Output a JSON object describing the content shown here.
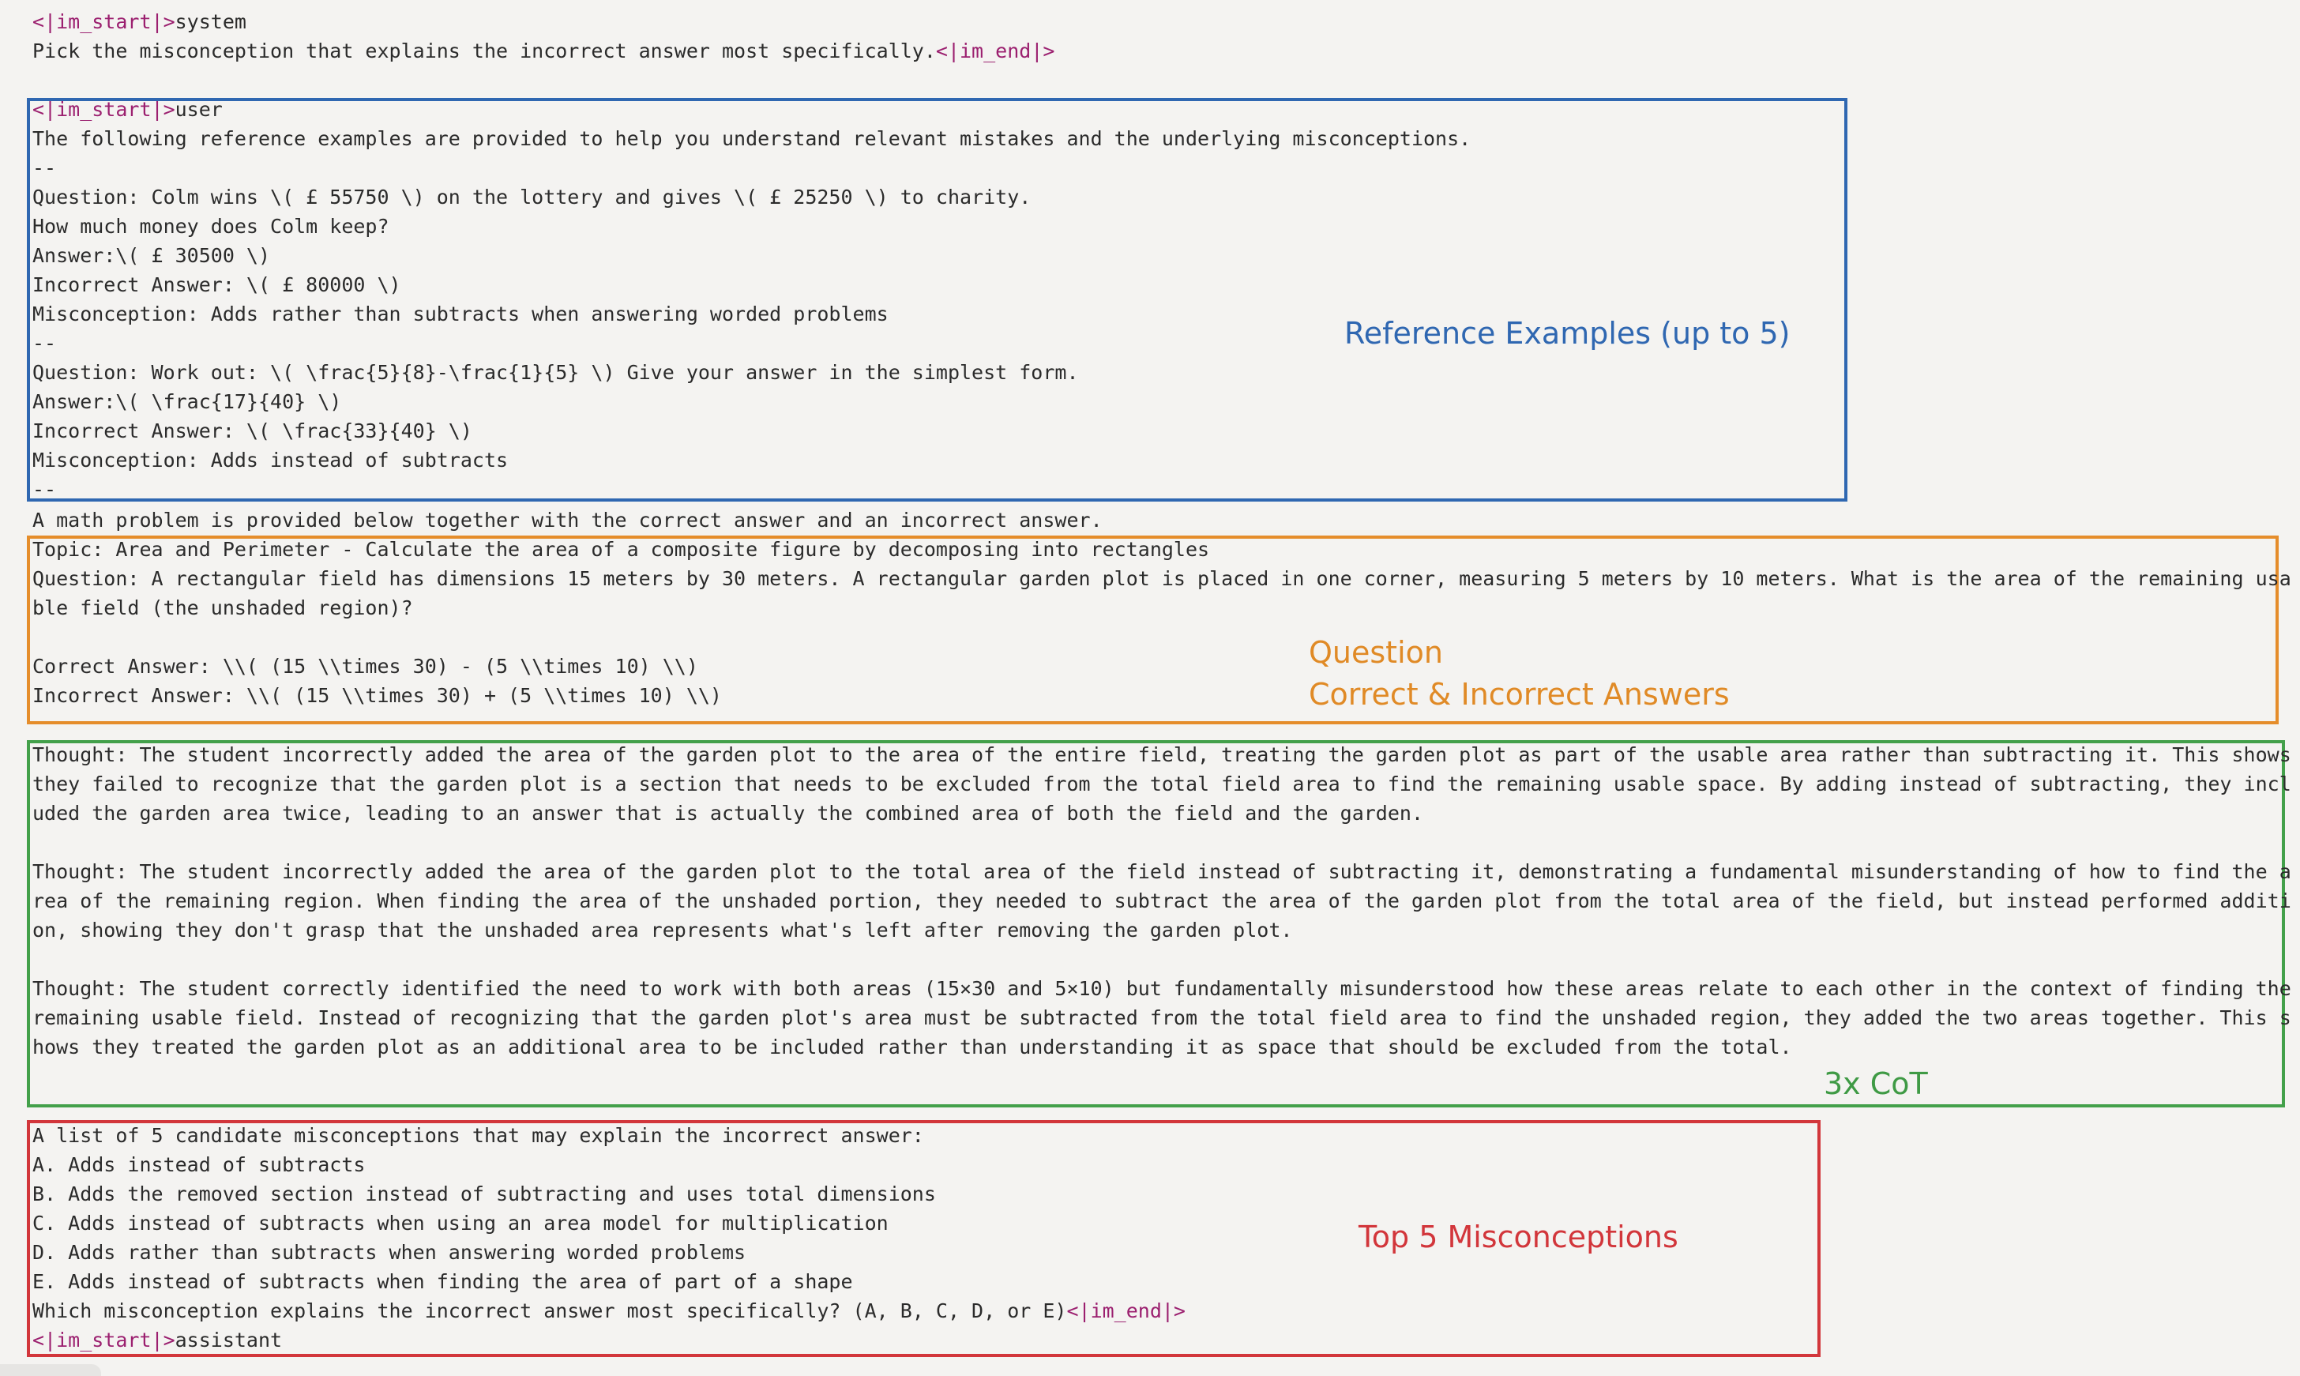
{
  "system_block": {
    "start_token": "<|im_start|>",
    "role": "system",
    "instruction": "Pick the misconception that explains the incorrect answer most specifically.",
    "end_token": "<|im_end|>"
  },
  "user_block": {
    "start_token": "<|im_start|>",
    "role": "user",
    "intro": "The following reference examples are provided to help you understand relevant mistakes and the underlying misconceptions.",
    "separator": "--",
    "examples": [
      {
        "question_line1": "Question: Colm wins \\( £ 55750 \\) on the lottery and gives \\( £ 25250 \\) to charity.",
        "question_line2": "How much money does Colm keep?",
        "answer": "Answer:\\( £ 30500 \\)",
        "incorrect": "Incorrect Answer: \\( £ 80000 \\)",
        "misconception": "Misconception: Adds rather than subtracts when answering worded problems"
      },
      {
        "question_line1": "Question: Work out: \\( \\frac{5}{8}-\\frac{1}{5} \\) Give your answer in the simplest form.",
        "answer": "Answer:\\( \\frac{17}{40} \\)",
        "incorrect": "Incorrect Answer: \\( \\frac{33}{40} \\)",
        "misconception": "Misconception: Adds instead of subtracts"
      }
    ]
  },
  "problem": {
    "intro": "A math problem is provided below together with the correct answer and an incorrect answer.",
    "topic": "Topic: Area and Perimeter - Calculate the area of a composite figure by decomposing into rectangles",
    "question_line1": "Question: A rectangular field has dimensions 15 meters by 30 meters. A rectangular garden plot is placed in one corner, measuring 5 meters by 10 meters. What is the area of the remaining usa",
    "question_line2": "ble field (the unshaded region)?",
    "correct": "Correct Answer: \\\\( (15 \\\\times 30) - (5 \\\\times 10) \\\\)",
    "incorrect": "Incorrect Answer: \\\\( (15 \\\\times 30) + (5 \\\\times 10) \\\\)"
  },
  "thoughts": [
    {
      "lines": [
        "Thought: The student incorrectly added the area of the garden plot to the area of the entire field, treating the garden plot as part of the usable area rather than subtracting it. This shows",
        "they failed to recognize that the garden plot is a section that needs to be excluded from the total field area to find the remaining usable space. By adding instead of subtracting, they incl",
        "uded the garden area twice, leading to an answer that is actually the combined area of both the field and the garden."
      ]
    },
    {
      "lines": [
        "Thought: The student incorrectly added the area of the garden plot to the total area of the field instead of subtracting it, demonstrating a fundamental misunderstanding of how to find the a",
        "rea of the remaining region. When finding the area of the unshaded portion, they needed to subtract the area of the garden plot from the total area of the field, but instead performed additi",
        "on, showing they don't grasp that the unshaded area represents what's left after removing the garden plot."
      ]
    },
    {
      "lines": [
        "Thought: The student correctly identified the need to work with both areas (15×30 and 5×10) but fundamentally misunderstood how these areas relate to each other in the context of finding the",
        "remaining usable field. Instead of recognizing that the garden plot's area must be subtracted from the total field area to find the unshaded region, they added the two areas together. This s",
        "hows they treated the garden plot as an additional area to be included rather than understanding it as space that should be excluded from the total."
      ]
    }
  ],
  "candidates": {
    "intro": "A list of 5 candidate misconceptions that may explain the incorrect answer:",
    "items": [
      "A. Adds instead of subtracts",
      "B. Adds the removed section instead of subtracting and uses total dimensions",
      "C. Adds instead of subtracts when using an area model for multiplication",
      "D. Adds rather than subtracts when answering worded problems",
      "E. Adds instead of subtracts when finding the area of part of a shape"
    ],
    "question": "Which misconception explains the incorrect answer most specifically? (A, B, C, D, or E)",
    "end_token": "<|im_end|>",
    "assistant_start_token": "<|im_start|>",
    "assistant_role": "assistant"
  },
  "annotations": {
    "reference": "Reference Examples (up to 5)",
    "question_line1": "Question",
    "question_line2": "Correct & Incorrect Answers",
    "cot": "3x CoT",
    "misconceptions": "Top 5 Misconceptions"
  },
  "colors": {
    "token": "#9b1f6f",
    "blue": "#2f67b1",
    "orange": "#e58d2b",
    "green": "#43a04a",
    "red": "#d2363b"
  }
}
